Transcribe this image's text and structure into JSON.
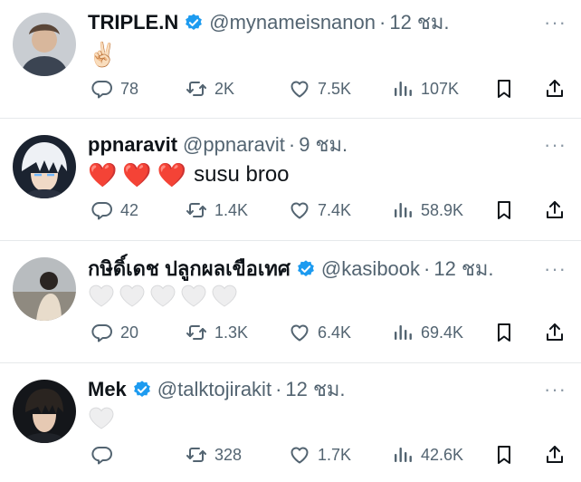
{
  "tweets": [
    {
      "name": "TRIPLE.N",
      "verified": true,
      "handle": "@mynameisnanon",
      "time": "12 ชม.",
      "text": "✌🏻",
      "replies": "78",
      "retweets": "2K",
      "likes": "7.5K",
      "views": "107K"
    },
    {
      "name": "ppnaravit",
      "verified": false,
      "handle": "@ppnaravit",
      "time": "9 ชม.",
      "text": "susu broo",
      "hearts": [
        "❤️",
        "❤️",
        "❤️"
      ],
      "replies": "42",
      "retweets": "1.4K",
      "likes": "7.4K",
      "views": "58.9K"
    },
    {
      "name": "กษิดิ์เดช ปลูกผลเขือเทศ",
      "verified": true,
      "handle": "@kasibook",
      "time": "12 ชม.",
      "white_hearts": 5,
      "replies": "20",
      "retweets": "1.3K",
      "likes": "6.4K",
      "views": "69.4K"
    },
    {
      "name": "Mek",
      "verified": true,
      "handle": "@talktojirakit",
      "time": "12 ชม.",
      "white_hearts": 1,
      "replies": "",
      "retweets": "328",
      "likes": "1.7K",
      "views": "42.6K"
    }
  ],
  "more_glyph": "···",
  "dot": "·",
  "colors": {
    "verified": "#1d9bf0",
    "meta": "#536471",
    "divider": "#e6e9eb",
    "red_heart": "#e8173a"
  },
  "icons": [
    "reply-icon",
    "retweet-icon",
    "like-icon",
    "views-icon",
    "bookmark-icon",
    "share-icon",
    "more-icon",
    "verified-badge-icon"
  ]
}
